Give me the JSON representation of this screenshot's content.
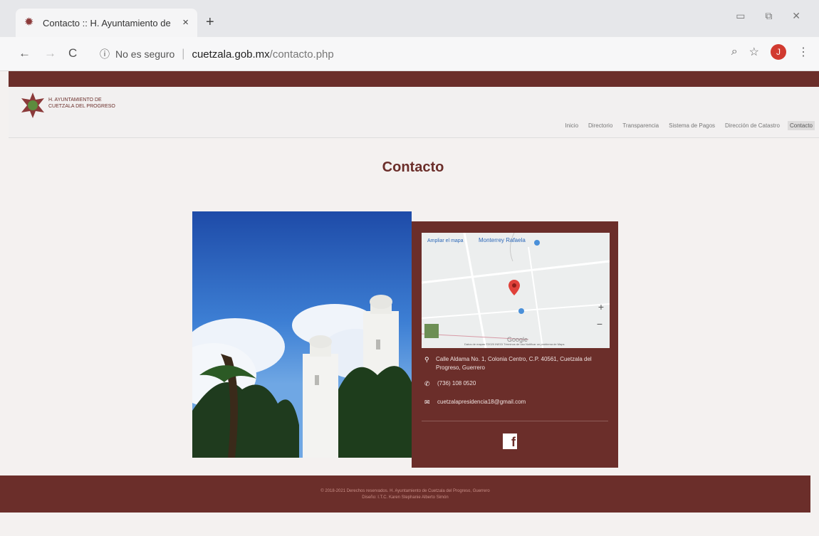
{
  "browser": {
    "tab_title": "Contacto :: H. Ayuntamiento de",
    "close": "×",
    "new_tab": "+",
    "window_controls": "▭ ⧉ ✕",
    "nav": {
      "back": "←",
      "forward": "→",
      "reload": "C"
    },
    "security_label": "No es seguro",
    "url_host": "cuetzala.gob.mx",
    "url_path": "/contacto.php",
    "avatar_letter": "J"
  },
  "site": {
    "logo_line1": "H. Ayuntamiento de",
    "logo_line2": "Cuetzala del Progreso",
    "nav": [
      "Inicio",
      "Directorio",
      "Transparencia",
      "Sistema de Pagos",
      "Dirección de Catastro",
      "Contacto"
    ],
    "page_title": "Contacto"
  },
  "contact": {
    "map_link": "Ampliar el mapa",
    "map_place": "Monterrey Rafaela",
    "map_plus": "+",
    "map_minus": "−",
    "map_google": "Google",
    "map_footer": "Datos de mapas ©2020 INEGI   Términos de uso   Notificar un problema de Maps",
    "address": "Calle Aldama No. 1, Colonia Centro, C.P. 40561, Cuetzala del Progreso, Guerrero",
    "phone": "(736) 108 0520",
    "email": "cuetzalapresidencia18@gmail.com",
    "facebook_glyph": "f"
  },
  "footer": {
    "line1": "© 2018-2021 Derechos reservados. H. Ayuntamiento de Cuetzala del Progreso, Guerrero",
    "line2": "Diseño: I.T.C. Karen Stephanie Alberto Simón"
  }
}
